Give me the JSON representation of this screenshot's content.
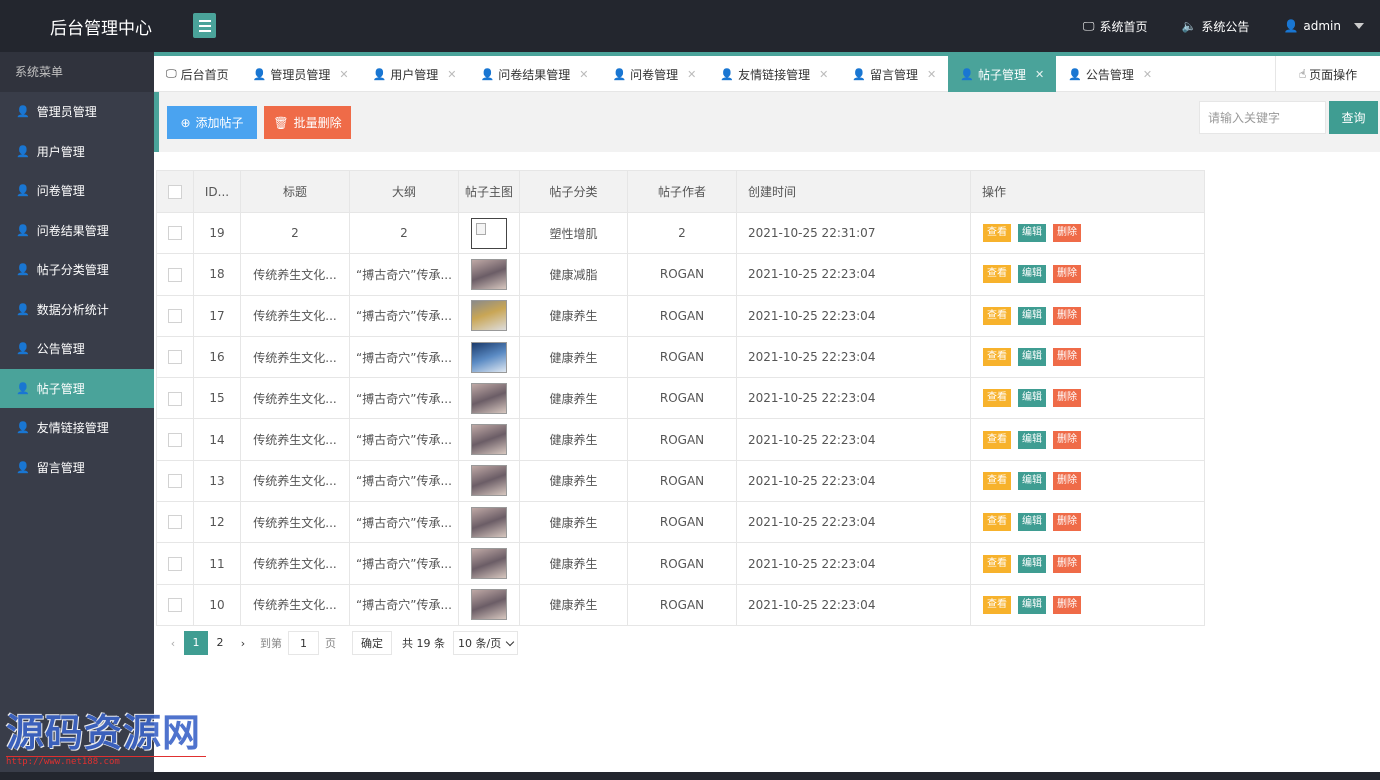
{
  "header": {
    "title": "后台管理中心",
    "links": [
      {
        "icon": "monitor-icon",
        "glyph": "🖵",
        "label": "系统首页"
      },
      {
        "icon": "speaker-icon",
        "glyph": "🔈",
        "label": "系统公告"
      }
    ],
    "user": {
      "icon": "user-icon",
      "glyph": "👤",
      "label": "admin"
    }
  },
  "sidebar": {
    "title": "系统菜单",
    "items": [
      {
        "label": "管理员管理"
      },
      {
        "label": "用户管理"
      },
      {
        "label": "问卷管理"
      },
      {
        "label": "问卷结果管理"
      },
      {
        "label": "帖子分类管理"
      },
      {
        "label": "数据分析统计"
      },
      {
        "label": "公告管理"
      },
      {
        "label": "帖子管理",
        "active": true
      },
      {
        "label": "友情链接管理"
      },
      {
        "label": "留言管理"
      }
    ]
  },
  "tabs": {
    "items": [
      {
        "label": "后台首页",
        "icon": "monitor-icon",
        "closable": false
      },
      {
        "label": "管理员管理",
        "icon": "user-icon",
        "closable": true
      },
      {
        "label": "用户管理",
        "icon": "user-icon",
        "closable": true
      },
      {
        "label": "问卷结果管理",
        "icon": "user-icon",
        "closable": true
      },
      {
        "label": "问卷管理",
        "icon": "user-icon",
        "closable": true
      },
      {
        "label": "友情链接管理",
        "icon": "user-icon",
        "closable": true
      },
      {
        "label": "留言管理",
        "icon": "user-icon",
        "closable": true
      },
      {
        "label": "帖子管理",
        "icon": "user-icon",
        "closable": true,
        "active": true
      },
      {
        "label": "公告管理",
        "icon": "user-icon",
        "closable": true
      }
    ],
    "page_ops_label": "页面操作"
  },
  "toolbar": {
    "add_label": "添加帖子",
    "batch_delete_label": "批量删除",
    "search_placeholder": "请输入关键字",
    "search_label": "查询"
  },
  "table": {
    "headers": [
      "ID...",
      "标题",
      "大纲",
      "帖子主图",
      "帖子分类",
      "帖子作者",
      "创建时间",
      "操作"
    ],
    "action_labels": {
      "view": "查看",
      "edit": "编辑",
      "delete": "删除"
    },
    "rows": [
      {
        "id": "19",
        "title": "2",
        "outline": "2",
        "image": "broken",
        "category": "塑性增肌",
        "author": "2",
        "created": "2021-10-25 22:31:07"
      },
      {
        "id": "18",
        "title": "传统养生文化...",
        "outline": "“搏古奇穴”传承...",
        "image": "a",
        "category": "健康减脂",
        "author": "ROGAN",
        "created": "2021-10-25 22:23:04"
      },
      {
        "id": "17",
        "title": "传统养生文化...",
        "outline": "“搏古奇穴”传承...",
        "image": "b",
        "category": "健康养生",
        "author": "ROGAN",
        "created": "2021-10-25 22:23:04"
      },
      {
        "id": "16",
        "title": "传统养生文化...",
        "outline": "“搏古奇穴”传承...",
        "image": "c",
        "category": "健康养生",
        "author": "ROGAN",
        "created": "2021-10-25 22:23:04"
      },
      {
        "id": "15",
        "title": "传统养生文化...",
        "outline": "“搏古奇穴”传承...",
        "image": "a",
        "category": "健康养生",
        "author": "ROGAN",
        "created": "2021-10-25 22:23:04"
      },
      {
        "id": "14",
        "title": "传统养生文化...",
        "outline": "“搏古奇穴”传承...",
        "image": "a",
        "category": "健康养生",
        "author": "ROGAN",
        "created": "2021-10-25 22:23:04"
      },
      {
        "id": "13",
        "title": "传统养生文化...",
        "outline": "“搏古奇穴”传承...",
        "image": "a",
        "category": "健康养生",
        "author": "ROGAN",
        "created": "2021-10-25 22:23:04"
      },
      {
        "id": "12",
        "title": "传统养生文化...",
        "outline": "“搏古奇穴”传承...",
        "image": "a",
        "category": "健康养生",
        "author": "ROGAN",
        "created": "2021-10-25 22:23:04"
      },
      {
        "id": "11",
        "title": "传统养生文化...",
        "outline": "“搏古奇穴”传承...",
        "image": "a",
        "category": "健康养生",
        "author": "ROGAN",
        "created": "2021-10-25 22:23:04"
      },
      {
        "id": "10",
        "title": "传统养生文化...",
        "outline": "“搏古奇穴”传承...",
        "image": "a",
        "category": "健康养生",
        "author": "ROGAN",
        "created": "2021-10-25 22:23:04"
      }
    ]
  },
  "pagination": {
    "pages": [
      "1",
      "2"
    ],
    "current": "1",
    "goto_label": "到第",
    "goto_value": "1",
    "page_unit": "页",
    "confirm_label": "确定",
    "total_label": "共 19 条",
    "page_size_label": "10 条/页"
  },
  "watermark": {
    "text": "源码资源网",
    "url": "http://www.net188.com"
  },
  "colors": {
    "accent": "#4aa39a",
    "header_bg": "#23262e",
    "sidebar_bg": "#393d49",
    "add_button": "#4aa3f0",
    "delete_button": "#ef6b48",
    "view_button": "#f7b22c"
  }
}
